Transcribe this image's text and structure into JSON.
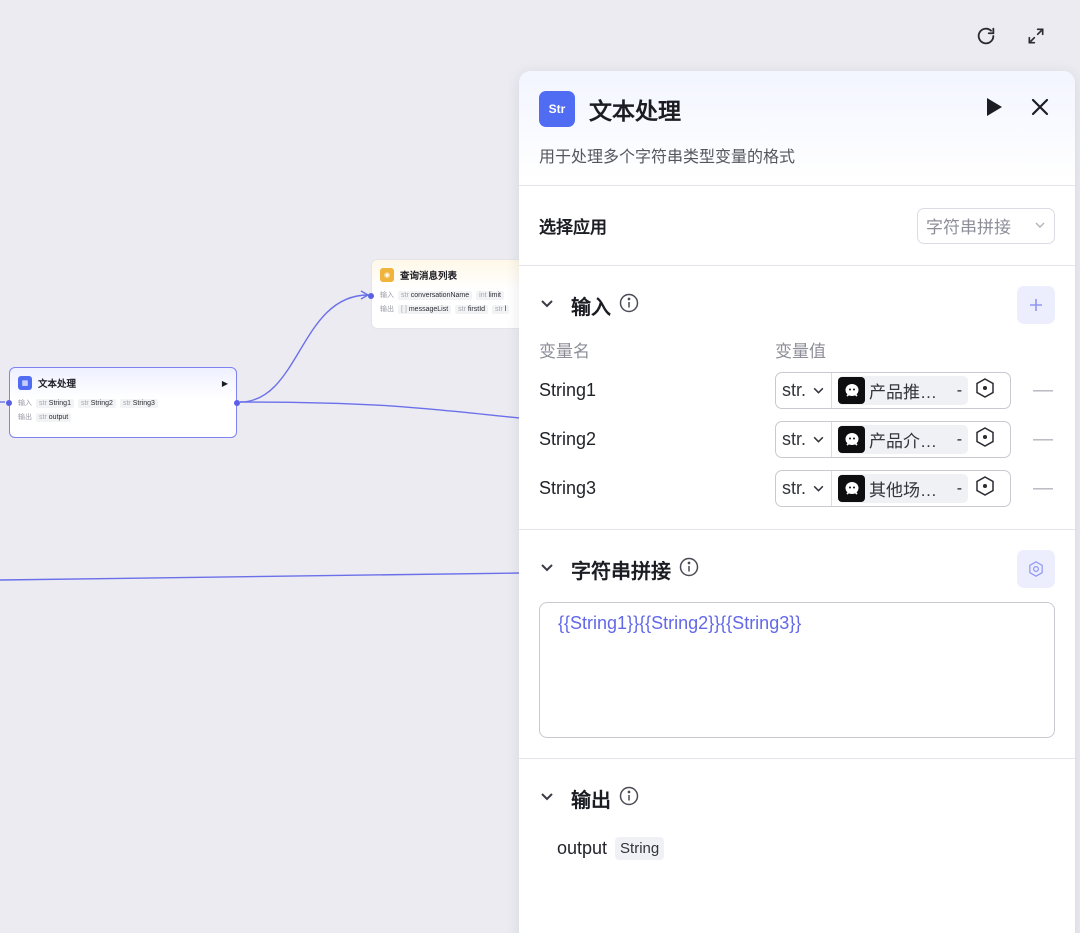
{
  "canvas": {
    "nodes": {
      "text_process": {
        "title": "文本处理",
        "input_label": "输入",
        "inputs": [
          {
            "type": "str",
            "name": "String1"
          },
          {
            "type": "str",
            "name": "String2"
          },
          {
            "type": "str",
            "name": "String3"
          }
        ],
        "output_label": "输出",
        "outputs": [
          {
            "type": "str",
            "name": "output"
          }
        ]
      },
      "query_messages": {
        "title": "查询消息列表",
        "input_label": "输入",
        "inputs": [
          {
            "type": "str",
            "name": "conversationName"
          },
          {
            "type": "int",
            "name": "limit"
          }
        ],
        "output_label": "输出",
        "outputs": [
          {
            "type": "[ ]",
            "name": "messageList"
          },
          {
            "type": "str",
            "name": "firstId"
          },
          {
            "type": "str",
            "name": "l"
          }
        ]
      }
    }
  },
  "panel": {
    "icon_text": "Str",
    "title": "文本处理",
    "description": "用于处理多个字符串类型变量的格式",
    "app_section": {
      "label": "选择应用",
      "selected": "字符串拼接"
    },
    "input_section": {
      "title": "输入",
      "col_name": "变量名",
      "col_value": "变量值",
      "rows": [
        {
          "name": "String1",
          "type": "str.",
          "ref": "产品推…",
          "suffix": "-"
        },
        {
          "name": "String2",
          "type": "str.",
          "ref": "产品介…",
          "suffix": "-"
        },
        {
          "name": "String3",
          "type": "str.",
          "ref": "其他场…",
          "suffix": "-"
        }
      ]
    },
    "concat_section": {
      "title": "字符串拼接",
      "template": "{{String1}}{{String2}}{{String3}}"
    },
    "output_section": {
      "title": "输出",
      "name": "output",
      "type": "String"
    }
  },
  "colors": {
    "accent": "#5a60e6",
    "panel_icon": "#4f6cf3",
    "template_text": "#6268e8"
  }
}
